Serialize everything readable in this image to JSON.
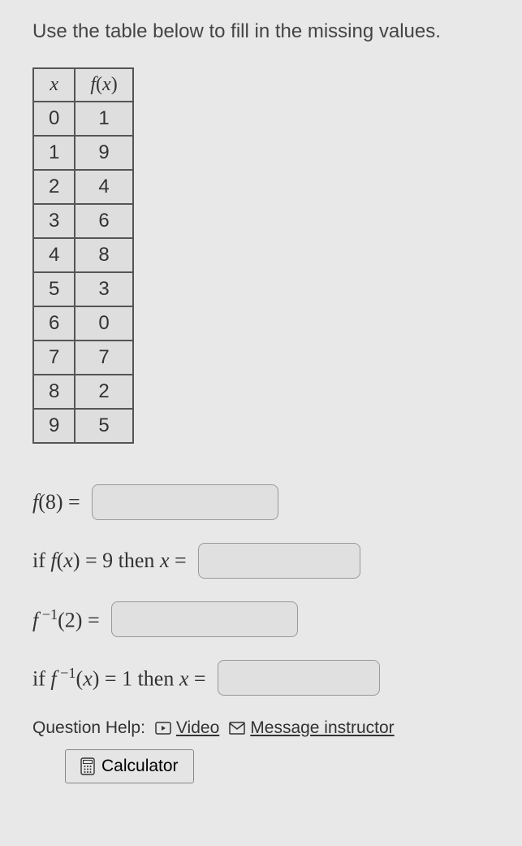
{
  "instructions": "Use the table below to fill in the missing values.",
  "table": {
    "headers": {
      "x": "x",
      "fx": "f(x)"
    },
    "rows": [
      {
        "x": "0",
        "fx": "1"
      },
      {
        "x": "1",
        "fx": "9"
      },
      {
        "x": "2",
        "fx": "4"
      },
      {
        "x": "3",
        "fx": "6"
      },
      {
        "x": "4",
        "fx": "8"
      },
      {
        "x": "5",
        "fx": "3"
      },
      {
        "x": "6",
        "fx": "0"
      },
      {
        "x": "7",
        "fx": "7"
      },
      {
        "x": "8",
        "fx": "2"
      },
      {
        "x": "9",
        "fx": "5"
      }
    ]
  },
  "questions": {
    "q1_prefix": "f(8) =",
    "q2_prefix": "if f(x) = 9 then x =",
    "q3_prefix_html": "f ⁻¹(2) =",
    "q4_prefix_html": "if f ⁻¹(x) = 1 then x ="
  },
  "help": {
    "label": "Question Help:",
    "video": "Video",
    "message": "Message instructor",
    "calculator": "Calculator"
  }
}
